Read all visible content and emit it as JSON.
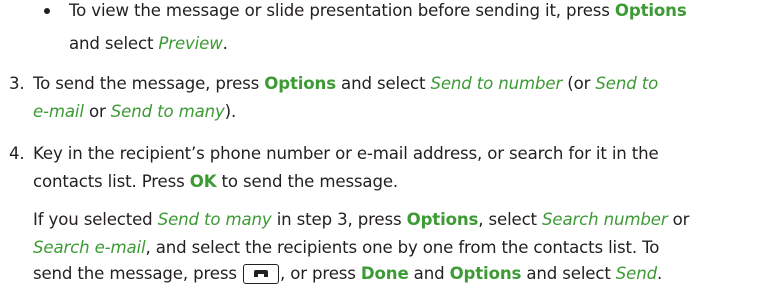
{
  "bullet_item": {
    "line1_text": "To view the message or slide presentation before sending it, press ",
    "line1_kw": "Options",
    "line2_text": "and select ",
    "line2_it": "Preview",
    "line2_end": "."
  },
  "step3": {
    "number": "3.",
    "text1": "To send the message, press ",
    "kw1": "Options",
    "text2": " and select ",
    "it1": "Send to number",
    "text3": " (or ",
    "it2a": "Send to",
    "it2b": "e-mail",
    "text4": " or ",
    "it3": "Send to many",
    "text5": ")."
  },
  "step4": {
    "number": "4.",
    "line1": "Key in the recipient’s phone number or e-mail address, or search for it in the",
    "line2_text": "contacts list. Press ",
    "line2_kw": "OK",
    "line2_end": " to send the message.",
    "p2_it1": "If you selected ",
    "p2_it1_val": "Send to many",
    "p2_t2": " in step 3, press ",
    "p2_kw1": "Options",
    "p2_t3": ", select ",
    "p2_it2": "Search number",
    "p2_t4": " or",
    "p2_it3": "Search e-mail",
    "p2_t5": ", and select the recipients one by one from the contacts list. To",
    "p2_t6": "send the message, press ",
    "p2_t7": ", or press ",
    "p2_kw2": "Done",
    "p2_t8": " and ",
    "p2_kw3": "Options",
    "p2_t9": " and select ",
    "p2_it4": "Send",
    "p2_t10": "."
  },
  "icons": {
    "send_key": "call-send-key-icon"
  }
}
